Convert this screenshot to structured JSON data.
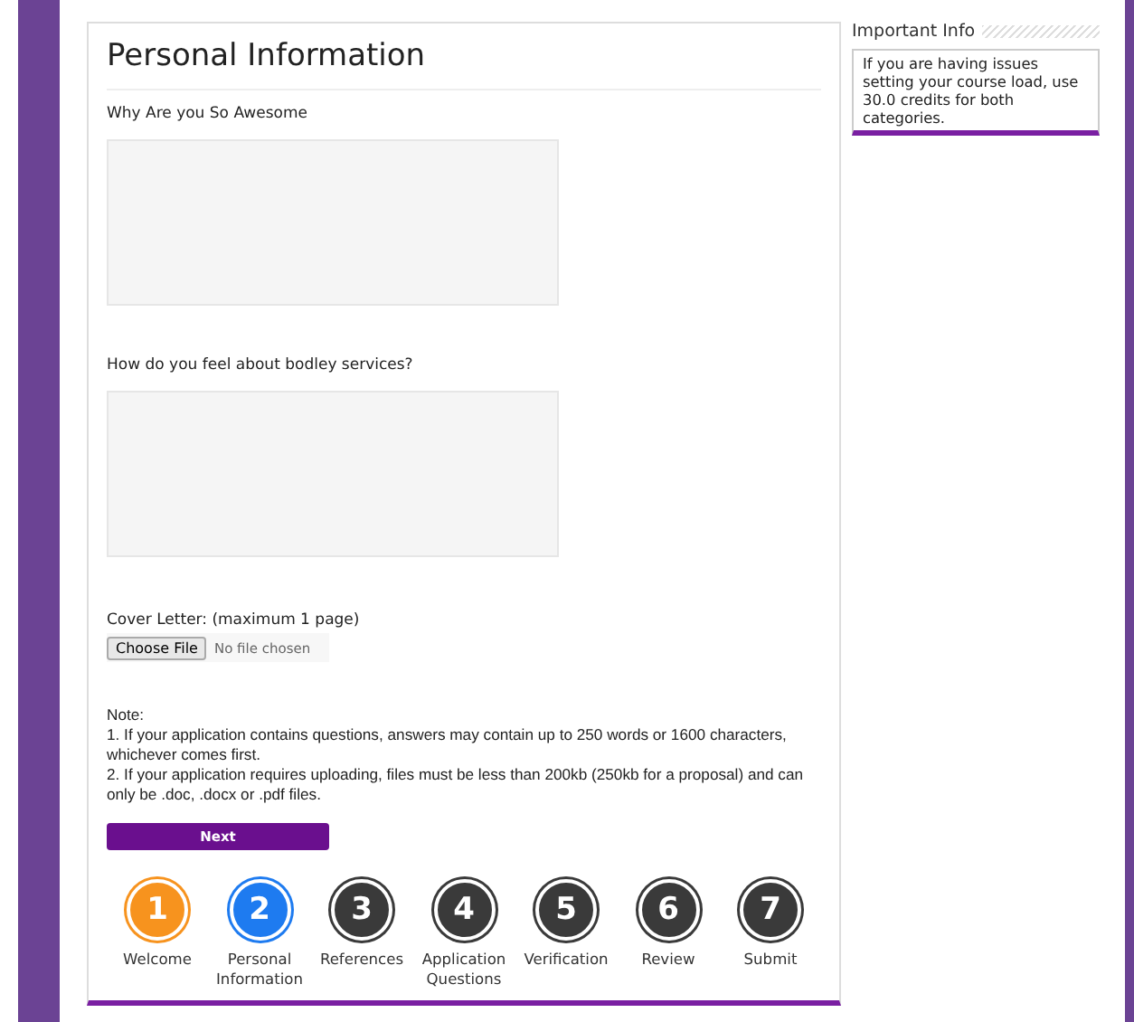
{
  "title": "Personal Information",
  "questions": [
    {
      "label": "Why Are you So Awesome"
    },
    {
      "label": "How do you feel about bodley services?"
    }
  ],
  "upload": {
    "label": "Cover Letter: (maximum 1 page)",
    "button": "Choose File",
    "status": "No file chosen"
  },
  "note": {
    "heading": "Note:",
    "lines": [
      "1. If your application contains questions, answers may contain up to 250 words or 1600 characters, whichever comes first.",
      "2. If your application requires uploading, files must be less than 200kb (250kb for a proposal) and can only be .doc, .docx or .pdf files."
    ]
  },
  "next_button": "Next",
  "steps": [
    {
      "number": "1",
      "label": "Welcome",
      "kind": "done"
    },
    {
      "number": "2",
      "label": "Personal Information",
      "kind": "current"
    },
    {
      "number": "3",
      "label": "References",
      "kind": "todo"
    },
    {
      "number": "4",
      "label": "Application Questions",
      "kind": "todo"
    },
    {
      "number": "5",
      "label": "Verification",
      "kind": "todo"
    },
    {
      "number": "6",
      "label": "Review",
      "kind": "todo"
    },
    {
      "number": "7",
      "label": "Submit",
      "kind": "todo"
    }
  ],
  "sidebar": {
    "title": "Important Info",
    "text": "If you are having issues setting your course load, use 30.0 credits for both categories."
  }
}
